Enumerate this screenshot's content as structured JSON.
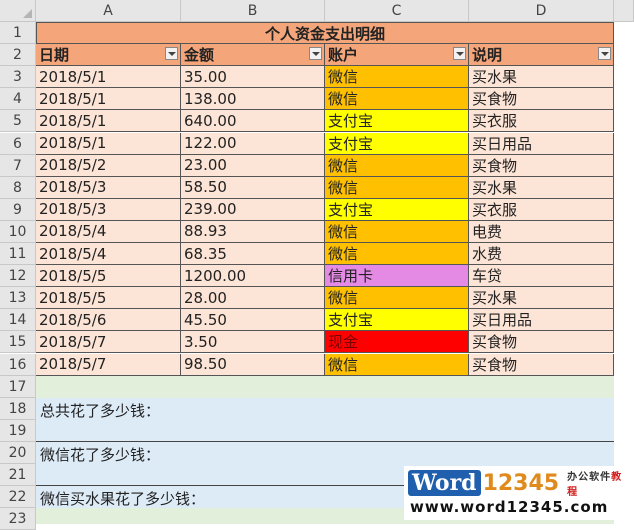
{
  "columns": [
    "A",
    "B",
    "C",
    "D"
  ],
  "rows": [
    "1",
    "2",
    "3",
    "4",
    "5",
    "6",
    "7",
    "8",
    "9",
    "10",
    "11",
    "12",
    "13",
    "14",
    "15",
    "16",
    "17",
    "18",
    "19",
    "20",
    "21",
    "22",
    "23"
  ],
  "title": "个人资金支出明细",
  "headers": [
    "日期",
    "金额",
    "账户",
    "说明"
  ],
  "colors": {
    "header_orange": "#f4a57a",
    "row_peach": "#fce4d6",
    "wechat": "#ffc000",
    "alipay": "#ffff00",
    "credit_card": "#e48ae4",
    "cash": "#ff0000",
    "question_blue": "#ddebf7",
    "row_green": "#e2efda"
  },
  "records": [
    {
      "date": "2018/5/1",
      "amount": "35.00",
      "account": "微信",
      "account_type": "wechat",
      "note": "买水果"
    },
    {
      "date": "2018/5/1",
      "amount": "138.00",
      "account": "微信",
      "account_type": "wechat",
      "note": "买食物"
    },
    {
      "date": "2018/5/1",
      "amount": "640.00",
      "account": "支付宝",
      "account_type": "alipay",
      "note": "买衣服"
    },
    {
      "date": "2018/5/1",
      "amount": "122.00",
      "account": "支付宝",
      "account_type": "alipay",
      "note": "买日用品"
    },
    {
      "date": "2018/5/2",
      "amount": "23.00",
      "account": "微信",
      "account_type": "wechat",
      "note": "买食物"
    },
    {
      "date": "2018/5/3",
      "amount": "58.50",
      "account": "微信",
      "account_type": "wechat",
      "note": "买水果"
    },
    {
      "date": "2018/5/3",
      "amount": "239.00",
      "account": "支付宝",
      "account_type": "alipay",
      "note": "买衣服"
    },
    {
      "date": "2018/5/4",
      "amount": "88.93",
      "account": "微信",
      "account_type": "wechat",
      "note": "电费"
    },
    {
      "date": "2018/5/4",
      "amount": "68.35",
      "account": "微信",
      "account_type": "wechat",
      "note": "水费"
    },
    {
      "date": "2018/5/5",
      "amount": "1200.00",
      "account": "信用卡",
      "account_type": "credit_card",
      "note": "车贷"
    },
    {
      "date": "2018/5/5",
      "amount": "28.00",
      "account": "微信",
      "account_type": "wechat",
      "note": "买水果"
    },
    {
      "date": "2018/5/6",
      "amount": "45.50",
      "account": "支付宝",
      "account_type": "alipay",
      "note": "买日用品"
    },
    {
      "date": "2018/5/7",
      "amount": "3.50",
      "account": "现金",
      "account_type": "cash",
      "note": "买食物"
    },
    {
      "date": "2018/5/7",
      "amount": "98.50",
      "account": "微信",
      "account_type": "wechat",
      "note": "买食物"
    }
  ],
  "questions": [
    "总共花了多少钱：",
    "微信花了多少钱：",
    "微信买水果花了多少钱："
  ],
  "watermark": {
    "brand_word": "Word",
    "brand_num": "12345",
    "tagline_a": "办公软件",
    "tagline_b": "教程",
    "url": "www.word12345.com"
  }
}
